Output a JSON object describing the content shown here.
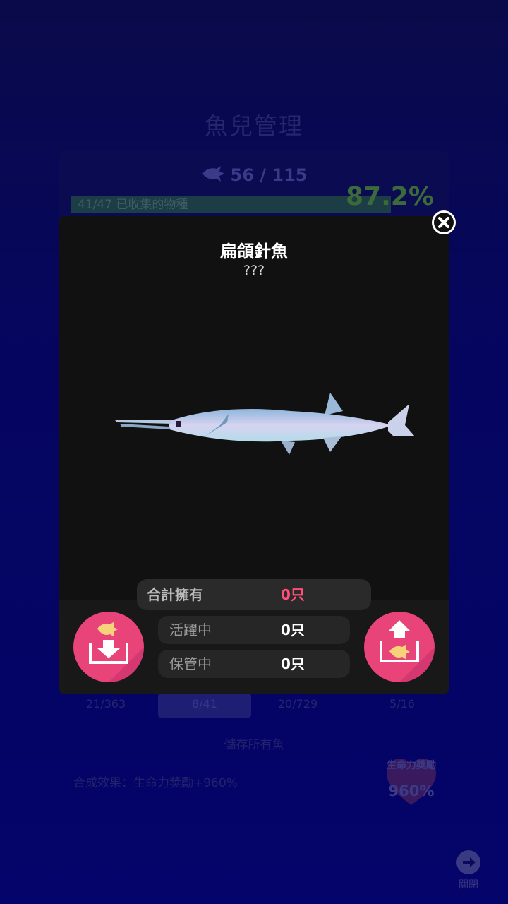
{
  "background": {
    "title": "魚兒管理",
    "fish_count": "56 / 115",
    "progress_text": "41/47 已收集的物種",
    "progress_fraction": 0.872,
    "percent": "87.2%",
    "tabs": [
      {
        "label": "21/363",
        "active": false
      },
      {
        "label": "8/41",
        "active": true
      },
      {
        "label": "20/729",
        "active": false
      },
      {
        "label": "5/16",
        "active": false
      }
    ],
    "store_all": "儲存所有魚",
    "effect": "合成效果：生命力獎勵+960%",
    "vitality_label": "生命力獎勵",
    "vitality_value": "960%",
    "close_label": "關閉"
  },
  "dialog": {
    "title": "扁頜針魚",
    "subtitle": "???",
    "stats": {
      "total_label": "合計擁有",
      "total_value": "0只",
      "active_label": "活躍中",
      "active_value": "0只",
      "stored_label": "保管中",
      "stored_value": "0只"
    }
  },
  "colors": {
    "accent_pink": "#e8447a",
    "total_value": "#ff4f7a",
    "fish_icon": "#f6d27a"
  },
  "icons": {
    "close": "close-icon",
    "store": "fish-store-icon",
    "release": "fish-release-icon"
  }
}
